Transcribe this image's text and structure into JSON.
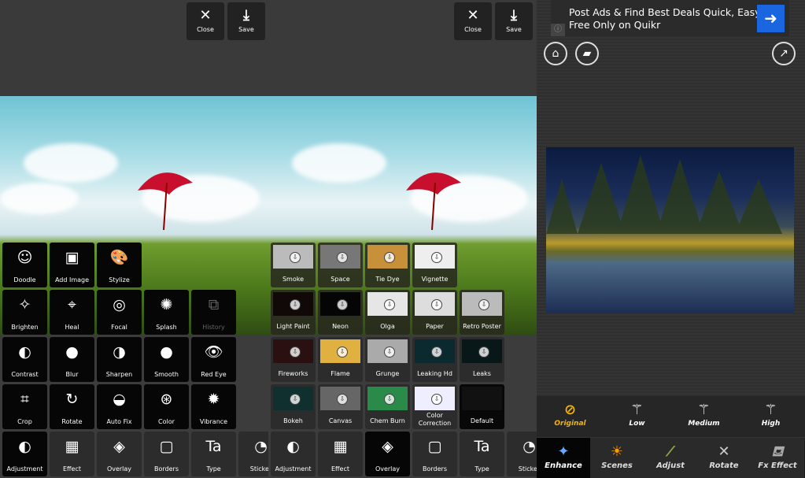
{
  "left_panel": {
    "close_label": "Close",
    "save_label": "Save",
    "tools": [
      {
        "label": "Doodle",
        "icon": "doodle-icon",
        "glyph": "☺"
      },
      {
        "label": "Add Image",
        "icon": "add-image-icon",
        "glyph": "▣"
      },
      {
        "label": "Stylize",
        "icon": "palette-icon",
        "glyph": "🎨"
      },
      {
        "label": "Brighten",
        "icon": "sparkle-icon",
        "glyph": "✧"
      },
      {
        "label": "Heal",
        "icon": "crosshair-icon",
        "glyph": "⌖"
      },
      {
        "label": "Focal",
        "icon": "target-icon",
        "glyph": "◎"
      },
      {
        "label": "Splash",
        "icon": "splash-icon",
        "glyph": "✺"
      },
      {
        "label": "History",
        "icon": "history-icon",
        "glyph": "⧉"
      },
      {
        "label": "Contrast",
        "icon": "contrast-icon",
        "glyph": "◐"
      },
      {
        "label": "Blur",
        "icon": "blur-icon",
        "glyph": "●"
      },
      {
        "label": "Sharpen",
        "icon": "sharpen-icon",
        "glyph": "◑"
      },
      {
        "label": "Smooth",
        "icon": "smooth-icon",
        "glyph": "●"
      },
      {
        "label": "Red Eye",
        "icon": "eye-icon",
        "glyph": "👁"
      },
      {
        "label": "Crop",
        "icon": "crop-icon",
        "glyph": "⌗"
      },
      {
        "label": "Rotate",
        "icon": "rotate-icon",
        "glyph": "↻"
      },
      {
        "label": "Auto Fix",
        "icon": "auto-fix-icon",
        "glyph": "◒"
      },
      {
        "label": "Color",
        "icon": "color-icon",
        "glyph": "⊛"
      },
      {
        "label": "Vibrance",
        "icon": "vibrance-icon",
        "glyph": "✹"
      }
    ]
  },
  "bottom_tabs": [
    {
      "label": "Adjustment",
      "icon": "adjustment-icon",
      "glyph": "◐"
    },
    {
      "label": "Effect",
      "icon": "film-icon",
      "glyph": "▦"
    },
    {
      "label": "Overlay",
      "icon": "layers-icon",
      "glyph": "◈"
    },
    {
      "label": "Borders",
      "icon": "border-icon",
      "glyph": "▢"
    },
    {
      "label": "Type",
      "icon": "type-icon",
      "glyph": "Ta"
    },
    {
      "label": "Sticker",
      "icon": "sticker-icon",
      "glyph": "◔"
    }
  ],
  "middle_panel": {
    "close_label": "Close",
    "save_label": "Save",
    "overlays": [
      {
        "label": "Smoke",
        "color": "#bbbbbb"
      },
      {
        "label": "Space",
        "color": "#777777"
      },
      {
        "label": "Tie Dye",
        "color": "#c9903a"
      },
      {
        "label": "Vignette",
        "color": "#eeeeee"
      },
      {
        "label": "Light Paint",
        "color": "#110808"
      },
      {
        "label": "Neon",
        "color": "#050505"
      },
      {
        "label": "Olga",
        "color": "#e6e6e6"
      },
      {
        "label": "Paper",
        "color": "#dddddd"
      },
      {
        "label": "Retro Poster",
        "color": "#bbbbbb"
      },
      {
        "label": "Fireworks",
        "color": "#2a1010"
      },
      {
        "label": "Flame",
        "color": "#e0b040"
      },
      {
        "label": "Grunge",
        "color": "#aaaaaa"
      },
      {
        "label": "Leaking Hd",
        "color": "#0a2a30"
      },
      {
        "label": "Leaks",
        "color": "#081818"
      },
      {
        "label": "Bokeh",
        "color": "#103030"
      },
      {
        "label": "Canvas",
        "color": "#666666"
      },
      {
        "label": "Chem Burn",
        "color": "#2a8a4a"
      },
      {
        "label": "Color Correction",
        "color": "#eeeeff"
      },
      {
        "label": "Default",
        "color": "#111111"
      }
    ]
  },
  "right_panel": {
    "ad_text": "Post Ads & Find Best Deals Quick, Easy & Free Only on Quikr",
    "enhance_levels": [
      {
        "label": "Original",
        "glyph": "⊘",
        "active": true
      },
      {
        "label": "Low",
        "glyph": "⚚"
      },
      {
        "label": "Medium",
        "glyph": "⚚"
      },
      {
        "label": "High",
        "glyph": "⚚"
      }
    ],
    "nav": [
      {
        "label": "Enhance",
        "icon": "magic-wand-icon",
        "glyph": "✦",
        "active": true
      },
      {
        "label": "Scenes",
        "icon": "sun-cloud-icon",
        "glyph": "☀"
      },
      {
        "label": "Adjust",
        "icon": "brush-icon",
        "glyph": "⁄"
      },
      {
        "label": "Rotate",
        "icon": "rotate-icon",
        "glyph": "✕"
      },
      {
        "label": "Fx Effect",
        "icon": "paint-bucket-icon",
        "glyph": "⛾"
      }
    ],
    "accent": "#f5b400"
  }
}
